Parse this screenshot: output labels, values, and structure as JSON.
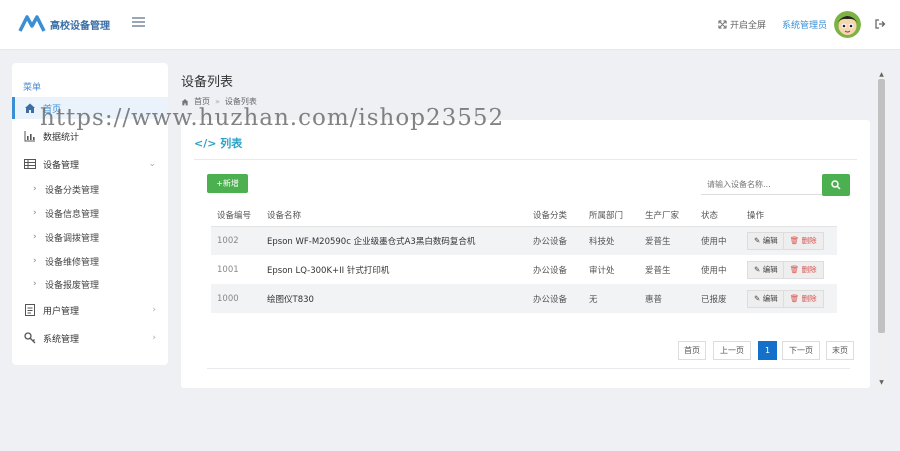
{
  "header": {
    "app_title": "高校设备管理",
    "fullscreen_label": "开启全屏",
    "admin_name": "系统管理员"
  },
  "sidebar": {
    "title": "菜单",
    "items": [
      {
        "label": "首页"
      },
      {
        "label": "数据统计"
      },
      {
        "label": "设备管理"
      },
      {
        "label": "用户管理"
      },
      {
        "label": "系统管理"
      }
    ],
    "sub_items": [
      {
        "label": "设备分类管理"
      },
      {
        "label": "设备信息管理"
      },
      {
        "label": "设备调拨管理"
      },
      {
        "label": "设备维修管理"
      },
      {
        "label": "设备报废管理"
      }
    ]
  },
  "page": {
    "title": "设备列表",
    "breadcrumb": [
      "首页",
      "设备列表"
    ],
    "breadcrumb_sep": "»"
  },
  "card": {
    "title": "列表",
    "add_label": "新增",
    "search_placeholder": "请输入设备名称..."
  },
  "table": {
    "headers": [
      "设备编号",
      "设备名称",
      "设备分类",
      "所属部门",
      "生产厂家",
      "状态",
      "操作"
    ],
    "rows": [
      {
        "code": "1002",
        "name": "Epson WF-M20590c 企业级墨仓式A3黑白数码复合机",
        "category": "办公设备",
        "dept": "科技处",
        "maker": "爱普生",
        "status": "使用中"
      },
      {
        "code": "1001",
        "name": "Epson LQ-300K+II 针式打印机",
        "category": "办公设备",
        "dept": "审计处",
        "maker": "爱普生",
        "status": "使用中"
      },
      {
        "code": "1000",
        "name": "绘图仪T830",
        "category": "办公设备",
        "dept": "无",
        "maker": "惠普",
        "status": "已报废"
      }
    ],
    "edit_label": "编辑",
    "delete_label": "删除"
  },
  "pagination": {
    "first": "首页",
    "prev": "上一页",
    "current": "1",
    "next": "下一页",
    "last": "末页"
  },
  "watermark": "https://www.huzhan.com/ishop23552",
  "colors": {
    "accent": "#3a8ed4",
    "success": "#4caf50",
    "title_cyan": "#2aa3c8",
    "page_active": "#1570c9",
    "danger": "#d9534f"
  }
}
